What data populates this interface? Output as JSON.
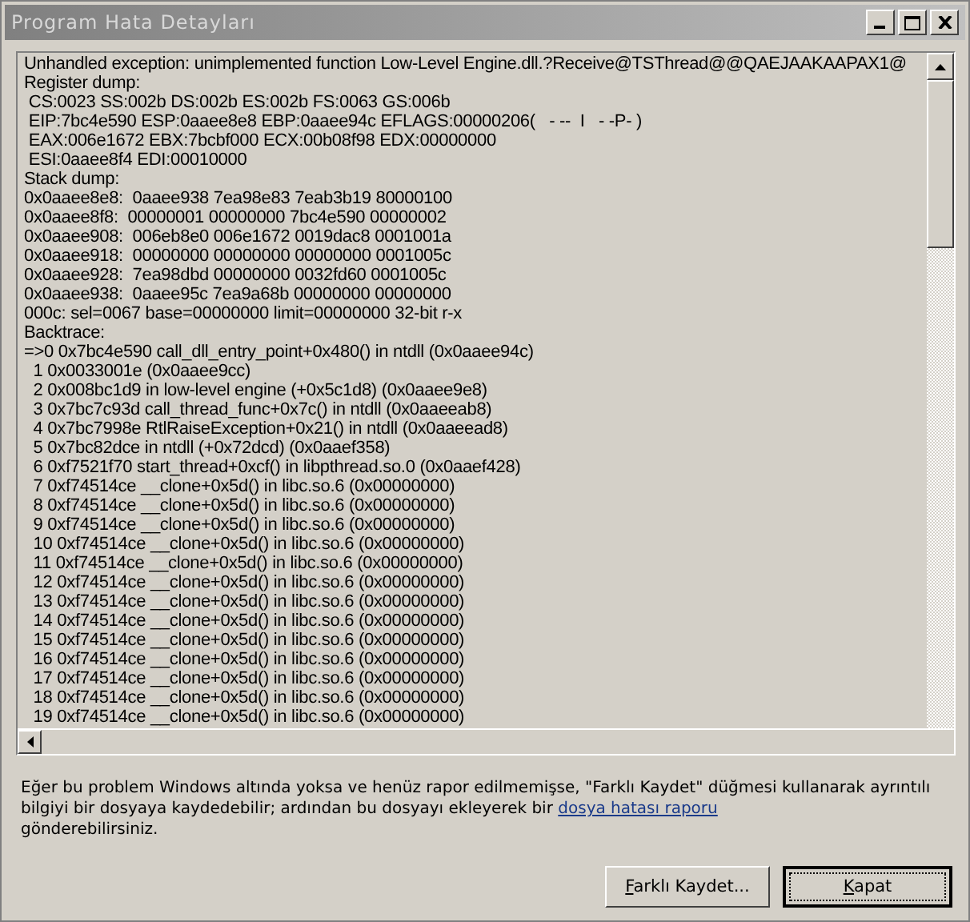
{
  "window": {
    "title": "Program Hata Detayları"
  },
  "log": {
    "lines": [
      "Unhandled exception: unimplemented function Low-Level Engine.dll.?Receive@TSThread@@QAEJAAKAAPAX1@",
      "Register dump:",
      " CS:0023 SS:002b DS:002b ES:002b FS:0063 GS:006b",
      " EIP:7bc4e590 ESP:0aaee8e8 EBP:0aaee94c EFLAGS:00000206(   - --  I   - -P- )",
      " EAX:006e1672 EBX:7bcbf000 ECX:00b08f98 EDX:00000000",
      " ESI:0aaee8f4 EDI:00010000",
      "Stack dump:",
      "0x0aaee8e8:  0aaee938 7ea98e83 7eab3b19 80000100",
      "0x0aaee8f8:  00000001 00000000 7bc4e590 00000002",
      "0x0aaee908:  006eb8e0 006e1672 0019dac8 0001001a",
      "0x0aaee918:  00000000 00000000 00000000 0001005c",
      "0x0aaee928:  7ea98dbd 00000000 0032fd60 0001005c",
      "0x0aaee938:  0aaee95c 7ea9a68b 00000000 00000000",
      "000c: sel=0067 base=00000000 limit=00000000 32-bit r-x",
      "Backtrace:",
      "=>0 0x7bc4e590 call_dll_entry_point+0x480() in ntdll (0x0aaee94c)",
      "  1 0x0033001e (0x0aaee9cc)",
      "  2 0x008bc1d9 in low-level engine (+0x5c1d8) (0x0aaee9e8)",
      "  3 0x7bc7c93d call_thread_func+0x7c() in ntdll (0x0aaeeab8)",
      "  4 0x7bc7998e RtlRaiseException+0x21() in ntdll (0x0aaeead8)",
      "  5 0x7bc82dce in ntdll (+0x72dcd) (0x0aaef358)",
      "  6 0xf7521f70 start_thread+0xcf() in libpthread.so.0 (0x0aaef428)",
      "  7 0xf74514ce __clone+0x5d() in libc.so.6 (0x00000000)",
      "  8 0xf74514ce __clone+0x5d() in libc.so.6 (0x00000000)",
      "  9 0xf74514ce __clone+0x5d() in libc.so.6 (0x00000000)",
      "  10 0xf74514ce __clone+0x5d() in libc.so.6 (0x00000000)",
      "  11 0xf74514ce __clone+0x5d() in libc.so.6 (0x00000000)",
      "  12 0xf74514ce __clone+0x5d() in libc.so.6 (0x00000000)",
      "  13 0xf74514ce __clone+0x5d() in libc.so.6 (0x00000000)",
      "  14 0xf74514ce __clone+0x5d() in libc.so.6 (0x00000000)",
      "  15 0xf74514ce __clone+0x5d() in libc.so.6 (0x00000000)",
      "  16 0xf74514ce __clone+0x5d() in libc.so.6 (0x00000000)",
      "  17 0xf74514ce __clone+0x5d() in libc.so.6 (0x00000000)",
      "  18 0xf74514ce __clone+0x5d() in libc.so.6 (0x00000000)",
      "  19 0xf74514ce __clone+0x5d() in libc.so.6 (0x00000000)"
    ]
  },
  "message": {
    "text": "Eğer bu problem Windows altında yoksa ve henüz rapor edilmemişse, \"Farklı Kaydet\" düğmesi kullanarak ayrıntılı bilgiyi bir dosyaya kaydedebilir; ardından bu dosyayı ekleyerek bir",
    "link": "dosya hatası raporu",
    "text_after": "gönderebilirsiniz."
  },
  "buttons": [
    {
      "label": "Farklı Kaydet...",
      "default": false
    },
    {
      "label": "Kapat",
      "default": true
    }
  ]
}
